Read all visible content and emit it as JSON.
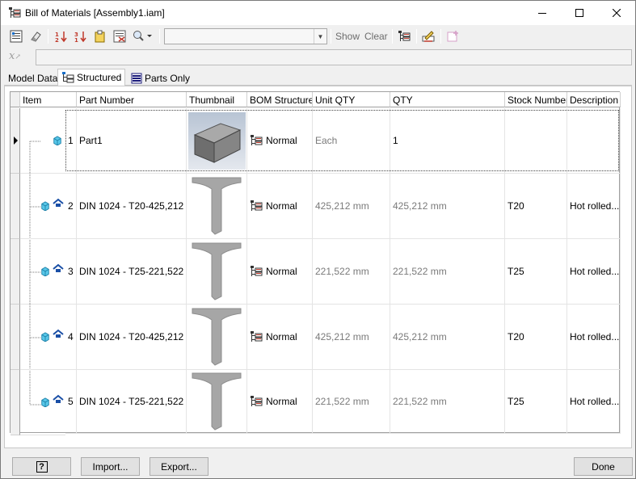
{
  "window": {
    "title": "Bill of Materials [Assembly1.iam]"
  },
  "toolbar": {
    "show_label": "Show",
    "clear_label": "Clear",
    "combo_value": ""
  },
  "formula": {
    "value": ""
  },
  "tabs": [
    {
      "label": "Model Data"
    },
    {
      "label": "Structured"
    },
    {
      "label": "Parts Only"
    }
  ],
  "columns": [
    "Item",
    "Part Number",
    "Thumbnail",
    "BOM Structure",
    "Unit QTY",
    "QTY",
    "Stock Number",
    "Description"
  ],
  "rows": [
    {
      "item": "1",
      "part_number": "Part1",
      "thumbnail": "box",
      "bom_structure": "Normal",
      "unit_qty": "Each",
      "qty": "1",
      "stock_number": "",
      "description": ""
    },
    {
      "item": "2",
      "part_number": "DIN 1024 - T20-425,212",
      "thumbnail": "tee",
      "bom_structure": "Normal",
      "unit_qty": "425,212 mm",
      "qty": "425,212 mm",
      "stock_number": "T20",
      "description": "Hot rolled..."
    },
    {
      "item": "3",
      "part_number": "DIN 1024 - T25-221,522",
      "thumbnail": "tee",
      "bom_structure": "Normal",
      "unit_qty": "221,522 mm",
      "qty": "221,522 mm",
      "stock_number": "T25",
      "description": "Hot rolled..."
    },
    {
      "item": "4",
      "part_number": "DIN 1024 - T20-425,212",
      "thumbnail": "tee",
      "bom_structure": "Normal",
      "unit_qty": "425,212 mm",
      "qty": "425,212 mm",
      "stock_number": "T20",
      "description": "Hot rolled..."
    },
    {
      "item": "5",
      "part_number": "DIN 1024 - T25-221,522",
      "thumbnail": "tee",
      "bom_structure": "Normal",
      "unit_qty": "221,522 mm",
      "qty": "221,522 mm",
      "stock_number": "T25",
      "description": "Hot rolled..."
    }
  ],
  "footer": {
    "help_label": "?",
    "import_label": "Import...",
    "export_label": "Export...",
    "done_label": "Done"
  }
}
